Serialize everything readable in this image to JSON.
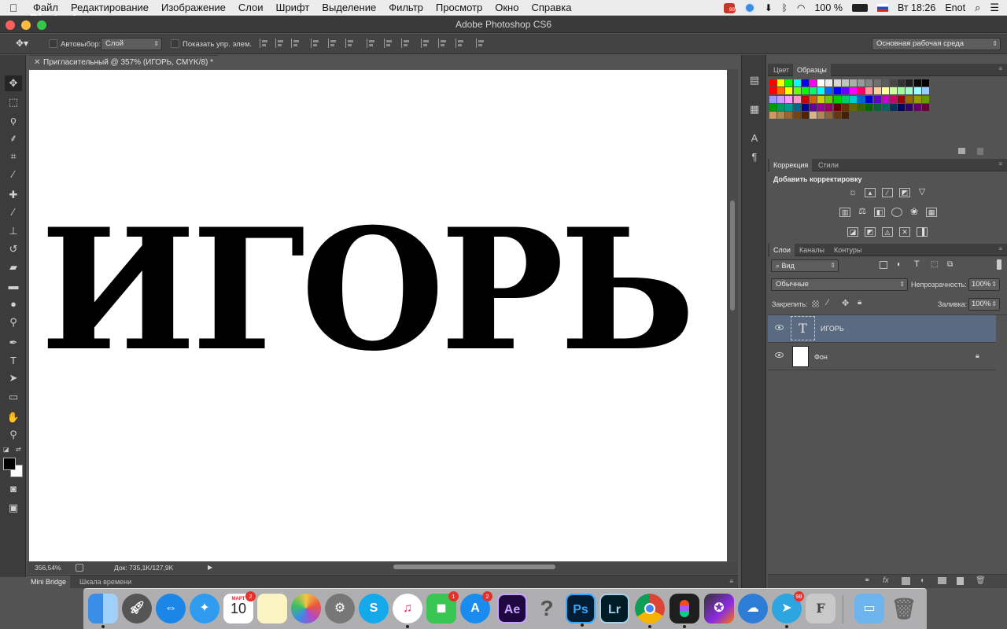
{
  "menubar": {
    "app_name": "Photoshop",
    "items": [
      "Файл",
      "Редактирование",
      "Изображение",
      "Слои",
      "Шрифт",
      "Выделение",
      "Фильтр",
      "Просмотр",
      "Окно",
      "Справка"
    ],
    "status": {
      "battery": "100 %",
      "clock": "Вт 18:26",
      "user": "Enot",
      "notify_badge": "98"
    }
  },
  "window": {
    "title": "Adobe Photoshop CS6"
  },
  "options": {
    "auto_select_label": "Автовыбор:",
    "auto_select_value": "Слой",
    "show_controls_label": "Показать упр. элем.",
    "workspace": "Основная рабочая среда"
  },
  "document": {
    "tab_title": "Пригласительный  @ 357% (ИГОРЬ, CMYK/8) *",
    "canvas_text": "ИГОРЬ",
    "zoom": "356,54%",
    "doc_info": "Док: 735,1K/127,9K"
  },
  "bottom_tabs": [
    "Mini Bridge",
    "Шкала времени"
  ],
  "panels": {
    "color_tabs": [
      "Цвет",
      "Образцы"
    ],
    "adjust_tabs": [
      "Коррекция",
      "Стили"
    ],
    "adjust_header": "Добавить корректировку",
    "layers_tabs": [
      "Слои",
      "Каналы",
      "Контуры"
    ],
    "layers_filter": "Вид",
    "blend_mode": "Обычные",
    "opacity_label": "Непрозрачность:",
    "opacity_value": "100%",
    "lock_label": "Закрепить:",
    "fill_label": "Заливка:",
    "fill_value": "100%",
    "layers": [
      {
        "name": "ИГОРЬ",
        "thumb": "T"
      },
      {
        "name": "Фон",
        "thumb": ""
      }
    ]
  },
  "dock": {
    "calendar_month": "МАРТ",
    "calendar_day": "10",
    "calendar_badge": "2",
    "facetime_badge": "1",
    "appstore_badge": "2",
    "telegram_badge": "98",
    "ae_label": "Ae",
    "ps_label": "Ps",
    "lr_label": "Lr",
    "help_label": "?",
    "f_label": "F"
  },
  "colors": {
    "accent_selection": "#5a6a80",
    "menubar": "#ececec",
    "panel_bg": "#535353"
  }
}
